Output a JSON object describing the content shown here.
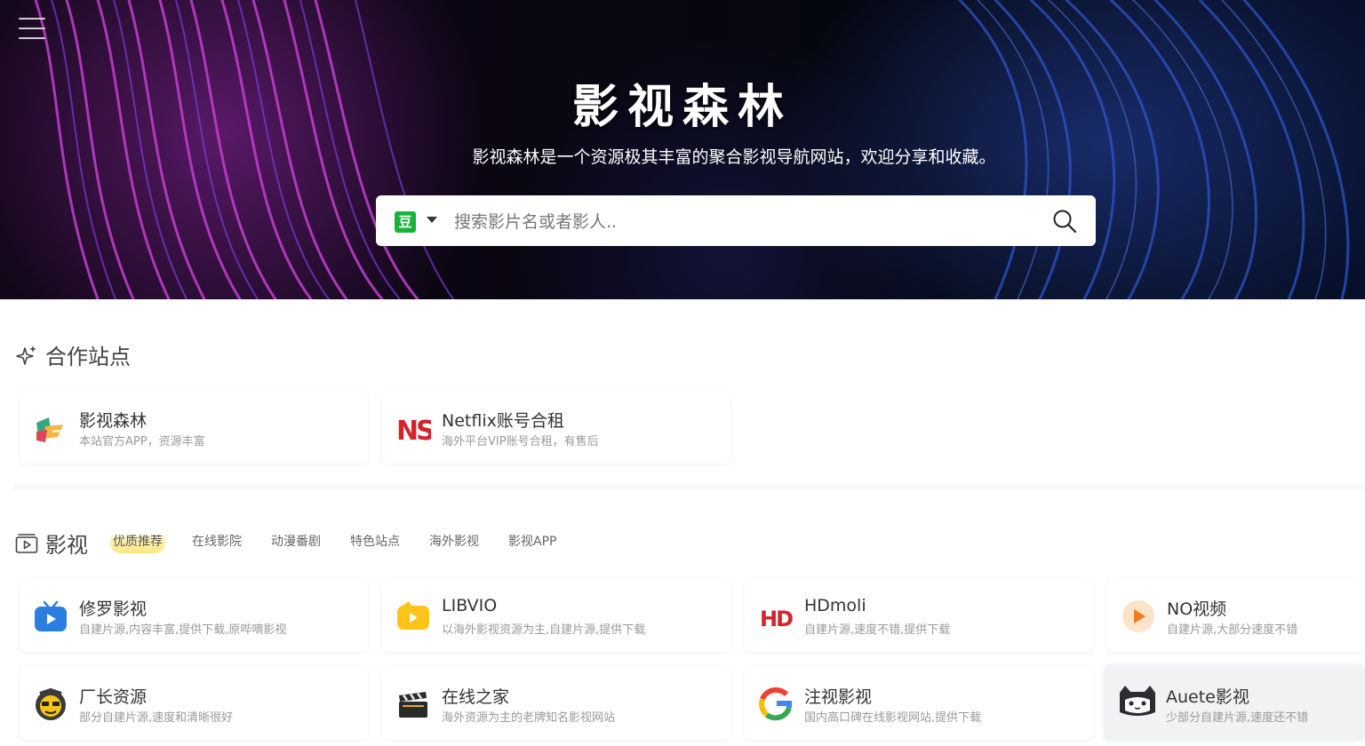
{
  "hero": {
    "title": "影视森林",
    "subtitle": "影视森林是一个资源极其丰富的聚合影视导航网站，欢迎分享和收藏。",
    "search": {
      "engine_badge": "豆",
      "placeholder": "搜索影片名或者影人.."
    }
  },
  "partner_section": {
    "title": "合作站点",
    "cards": [
      {
        "title": "影视森林",
        "desc": "本站官方APP，资源丰富"
      },
      {
        "title": "Netflix账号合租",
        "desc": "海外平台VIP账号合租，有售后"
      }
    ]
  },
  "video_section": {
    "title": "影视",
    "tabs": [
      "优质推荐",
      "在线影院",
      "动漫番剧",
      "特色站点",
      "海外影视",
      "影视APP"
    ],
    "active_tab": "优质推荐",
    "cards": [
      {
        "title": "修罗影视",
        "desc": "自建片源,内容丰富,提供下载,原哔嘀影视"
      },
      {
        "title": "LIBVIO",
        "desc": "以海外影视资源为主,自建片源,提供下载"
      },
      {
        "title": "HDmoli",
        "desc": "自建片源,速度不错,提供下载"
      },
      {
        "title": "NO视频",
        "desc": "自建片源,大部分速度不错"
      },
      {
        "title": "厂长资源",
        "desc": "部分自建片源,速度和清晰很好"
      },
      {
        "title": "在线之家",
        "desc": "海外资源为主的老牌知名影视网站"
      },
      {
        "title": "注视影视",
        "desc": "国内高口碑在线影视网站,提供下载"
      },
      {
        "title": "Auete影视",
        "desc": "少部分自建片源,速度还不错"
      }
    ]
  },
  "icons": {
    "menu": "hamburger-menu-icon",
    "search": "magnifier-icon",
    "sparkle": "sparkle-icon",
    "video": "video-play-icon"
  },
  "colors": {
    "engine_badge": "#19b33b",
    "active_tab_highlight": "#ffe680"
  }
}
